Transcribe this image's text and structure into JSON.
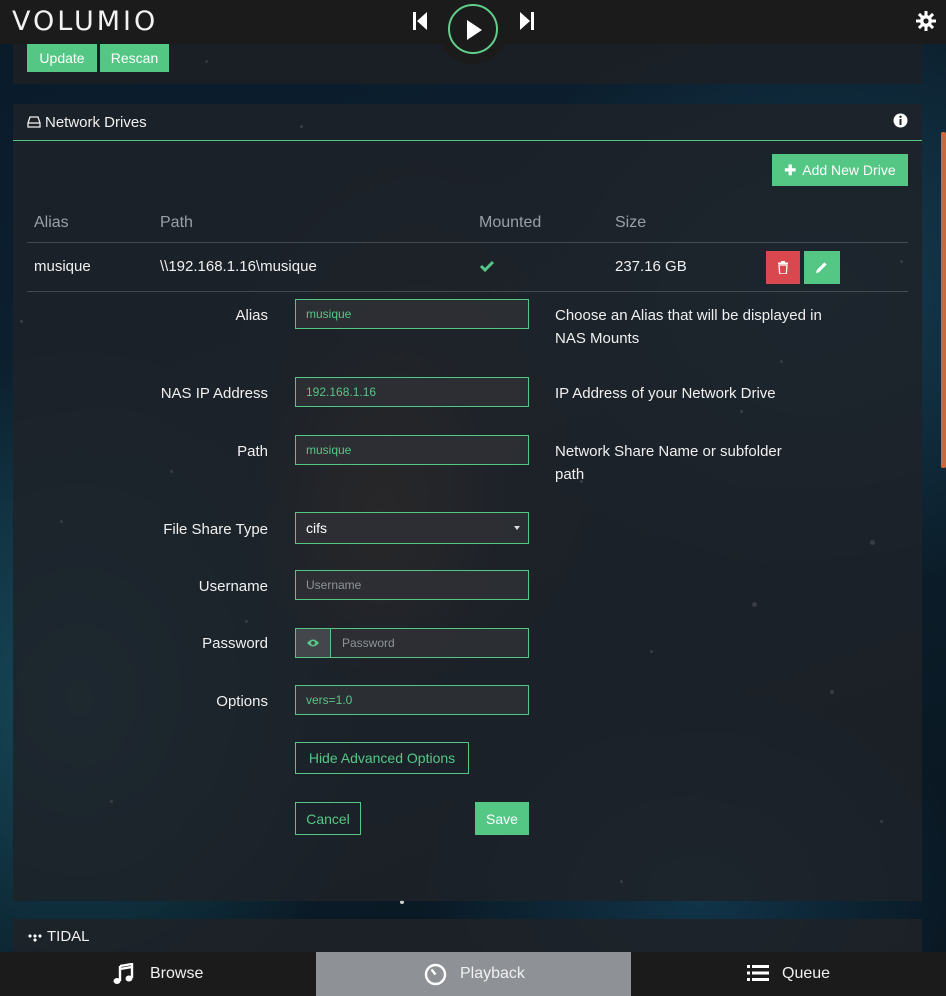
{
  "app": {
    "logo_text": "VOLUMIO"
  },
  "library": {
    "update_label": "Update",
    "rescan_label": "Rescan"
  },
  "network_drives": {
    "title": "Network Drives",
    "add_label": "Add New Drive",
    "columns": {
      "alias": "Alias",
      "path": "Path",
      "mounted": "Mounted",
      "size": "Size"
    },
    "row": {
      "alias": "musique",
      "path": "\\\\192.168.1.16\\musique",
      "size": "237.16 GB"
    }
  },
  "form": {
    "alias": {
      "label": "Alias",
      "value": "musique",
      "help": "Choose an Alias that will be displayed in NAS Mounts"
    },
    "ip": {
      "label": "NAS IP Address",
      "value": "192.168.1.16",
      "help": "IP Address of your Network Drive"
    },
    "path": {
      "label": "Path",
      "value": "musique",
      "help": "Network Share Name or subfolder path"
    },
    "share_type": {
      "label": "File Share Type",
      "value": "cifs"
    },
    "username": {
      "label": "Username",
      "placeholder": "Username"
    },
    "password": {
      "label": "Password",
      "placeholder": "Password"
    },
    "options": {
      "label": "Options",
      "value": "vers=1.0"
    },
    "hide_advanced_label": "Hide Advanced Options",
    "cancel_label": "Cancel",
    "save_label": "Save"
  },
  "tidal": {
    "title": "TIDAL"
  },
  "nav": {
    "browse": "Browse",
    "playback": "Playback",
    "queue": "Queue"
  },
  "colors": {
    "accent": "#54c785",
    "danger": "#d9474f",
    "bar": "#1b1b1b"
  }
}
